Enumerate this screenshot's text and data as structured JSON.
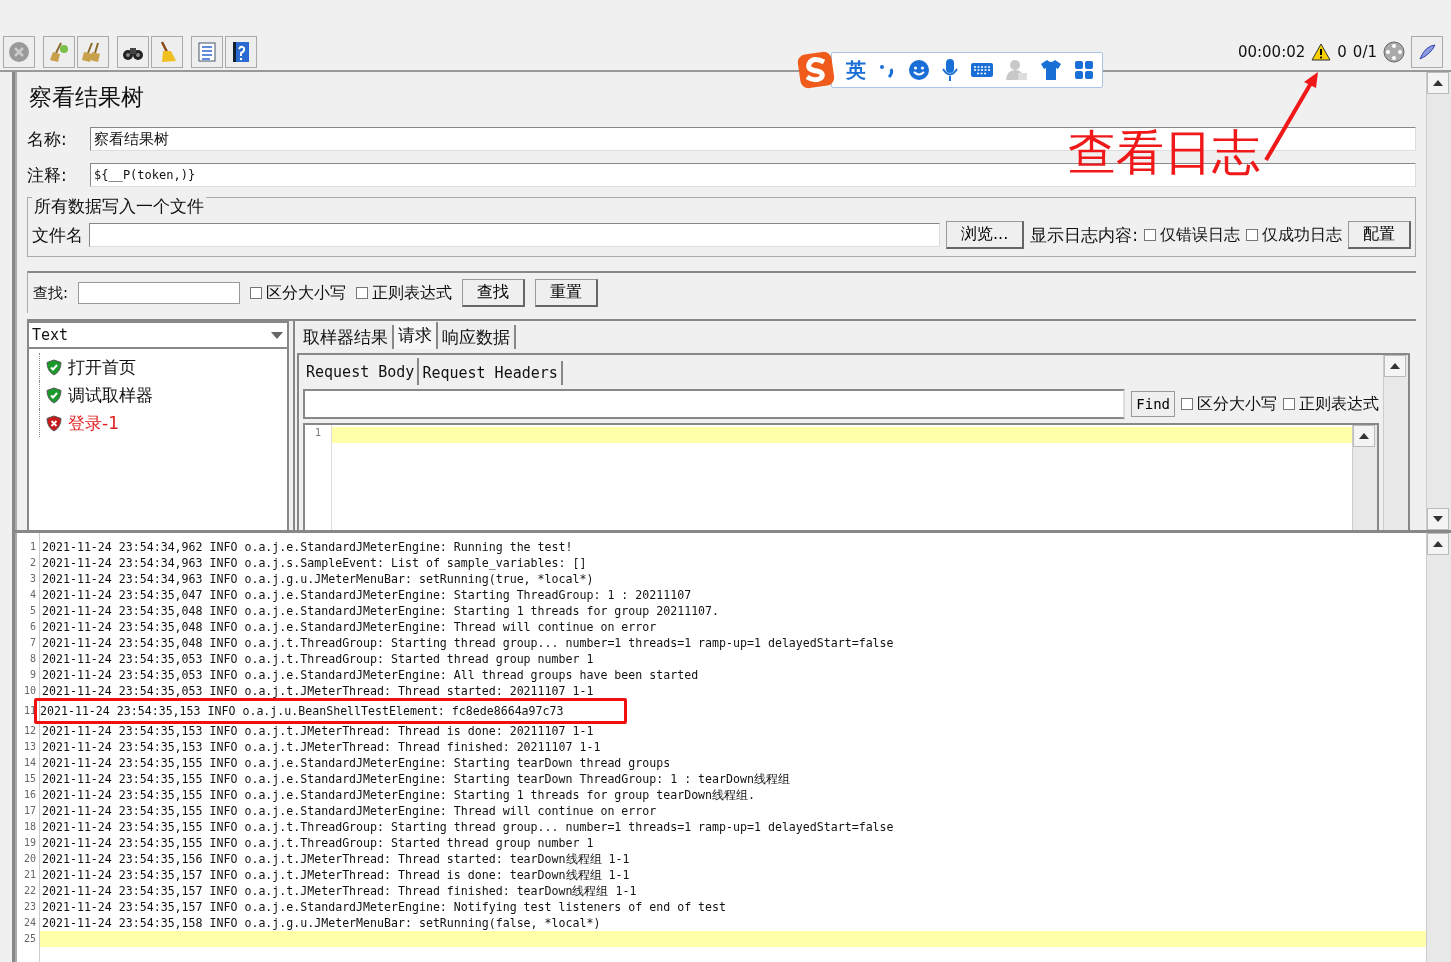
{
  "status": {
    "timer": "00:00:02",
    "warnings": "0",
    "threads": "0/1"
  },
  "ime_bar": {
    "mode": "英"
  },
  "annotation": {
    "text": "查看日志"
  },
  "panel": {
    "title": "察看结果树",
    "name_label": "名称:",
    "name_value": "察看结果树",
    "comment_label": "注释:",
    "comment_value": "${__P(token,)}"
  },
  "file_group": {
    "legend": "所有数据写入一个文件",
    "file_label": "文件名",
    "browse_button": "浏览...",
    "log_label": "显示日志内容:",
    "options": [
      {
        "label": "仅错误日志",
        "checked": false
      },
      {
        "label": "仅成功日志",
        "checked": false
      }
    ],
    "config_button": "配置"
  },
  "search": {
    "label": "查找:",
    "options": [
      {
        "label": "区分大小写",
        "checked": false
      },
      {
        "label": "正则表达式",
        "checked": false
      }
    ],
    "find_button": "查找",
    "reset_button": "重置"
  },
  "renderer": {
    "value": "Text"
  },
  "results": [
    {
      "label": "打开首页",
      "kind": "success"
    },
    {
      "label": "调试取样器",
      "kind": "success"
    },
    {
      "label": "登录-1",
      "kind": "failure"
    }
  ],
  "tabs": [
    {
      "label": "取样器结果",
      "selected": false
    },
    {
      "label": "请求",
      "selected": true
    },
    {
      "label": "响应数据",
      "selected": false
    }
  ],
  "sub_tabs": [
    {
      "label": "Request Body",
      "selected": true
    },
    {
      "label": "Request Headers",
      "selected": false
    }
  ],
  "editor_search": {
    "button": "Find",
    "options": [
      {
        "label": "区分大小写",
        "checked": false
      },
      {
        "label": "正则表达式",
        "checked": false
      }
    ]
  },
  "editor": {
    "lines": [
      {
        "number": "1",
        "current": true
      }
    ]
  },
  "log": [
    {
      "number": "1",
      "text": "2021-11-24 23:54:34,962 INFO o.a.j.e.StandardJMeterEngine: Running the test!",
      "current": false,
      "boxed": false
    },
    {
      "number": "2",
      "text": "2021-11-24 23:54:34,963 INFO o.a.j.s.SampleEvent: List of sample_variables: []",
      "current": false,
      "boxed": false
    },
    {
      "number": "3",
      "text": "2021-11-24 23:54:34,963 INFO o.a.j.g.u.JMeterMenuBar: setRunning(true, *local*)",
      "current": false,
      "boxed": false
    },
    {
      "number": "4",
      "text": "2021-11-24 23:54:35,047 INFO o.a.j.e.StandardJMeterEngine: Starting ThreadGroup: 1 : 20211107",
      "current": false,
      "boxed": false
    },
    {
      "number": "5",
      "text": "2021-11-24 23:54:35,048 INFO o.a.j.e.StandardJMeterEngine: Starting 1 threads for group 20211107.",
      "current": false,
      "boxed": false
    },
    {
      "number": "6",
      "text": "2021-11-24 23:54:35,048 INFO o.a.j.e.StandardJMeterEngine: Thread will continue on error",
      "current": false,
      "boxed": false
    },
    {
      "number": "7",
      "text": "2021-11-24 23:54:35,048 INFO o.a.j.t.ThreadGroup: Starting thread group... number=1 threads=1 ramp-up=1 delayedStart=false",
      "current": false,
      "boxed": false
    },
    {
      "number": "8",
      "text": "2021-11-24 23:54:35,053 INFO o.a.j.t.ThreadGroup: Started thread group number 1",
      "current": false,
      "boxed": false
    },
    {
      "number": "9",
      "text": "2021-11-24 23:54:35,053 INFO o.a.j.e.StandardJMeterEngine: All thread groups have been started",
      "current": false,
      "boxed": false
    },
    {
      "number": "10",
      "text": "2021-11-24 23:54:35,053 INFO o.a.j.t.JMeterThread: Thread started: 20211107 1-1",
      "current": false,
      "boxed": false
    },
    {
      "number": "11",
      "text": "2021-11-24 23:54:35,153 INFO o.a.j.u.BeanShellTestElement: fc8ede8664a97c73",
      "current": false,
      "boxed": true
    },
    {
      "number": "12",
      "text": "2021-11-24 23:54:35,153 INFO o.a.j.t.JMeterThread: Thread is done: 20211107 1-1",
      "current": false,
      "boxed": false
    },
    {
      "number": "13",
      "text": "2021-11-24 23:54:35,153 INFO o.a.j.t.JMeterThread: Thread finished: 20211107 1-1",
      "current": false,
      "boxed": false
    },
    {
      "number": "14",
      "text": "2021-11-24 23:54:35,155 INFO o.a.j.e.StandardJMeterEngine: Starting tearDown thread groups",
      "current": false,
      "boxed": false
    },
    {
      "number": "15",
      "text": "2021-11-24 23:54:35,155 INFO o.a.j.e.StandardJMeterEngine: Starting tearDown ThreadGroup: 1 : tearDown线程组",
      "current": false,
      "boxed": false
    },
    {
      "number": "16",
      "text": "2021-11-24 23:54:35,155 INFO o.a.j.e.StandardJMeterEngine: Starting 1 threads for group tearDown线程组.",
      "current": false,
      "boxed": false
    },
    {
      "number": "17",
      "text": "2021-11-24 23:54:35,155 INFO o.a.j.e.StandardJMeterEngine: Thread will continue on error",
      "current": false,
      "boxed": false
    },
    {
      "number": "18",
      "text": "2021-11-24 23:54:35,155 INFO o.a.j.t.ThreadGroup: Starting thread group... number=1 threads=1 ramp-up=1 delayedStart=false",
      "current": false,
      "boxed": false
    },
    {
      "number": "19",
      "text": "2021-11-24 23:54:35,155 INFO o.a.j.t.ThreadGroup: Started thread group number 1",
      "current": false,
      "boxed": false
    },
    {
      "number": "20",
      "text": "2021-11-24 23:54:35,156 INFO o.a.j.t.JMeterThread: Thread started: tearDown线程组 1-1",
      "current": false,
      "boxed": false
    },
    {
      "number": "21",
      "text": "2021-11-24 23:54:35,157 INFO o.a.j.t.JMeterThread: Thread is done: tearDown线程组 1-1",
      "current": false,
      "boxed": false
    },
    {
      "number": "22",
      "text": "2021-11-24 23:54:35,157 INFO o.a.j.t.JMeterThread: Thread finished: tearDown线程组 1-1",
      "current": false,
      "boxed": false
    },
    {
      "number": "23",
      "text": "2021-11-24 23:54:35,157 INFO o.a.j.e.StandardJMeterEngine: Notifying test listeners of end of test",
      "current": false,
      "boxed": false
    },
    {
      "number": "24",
      "text": "2021-11-24 23:54:35,158 INFO o.a.j.g.u.JMeterMenuBar: setRunning(false, *local*)",
      "current": false,
      "boxed": false
    },
    {
      "number": "25",
      "current": true,
      "boxed": false
    }
  ]
}
